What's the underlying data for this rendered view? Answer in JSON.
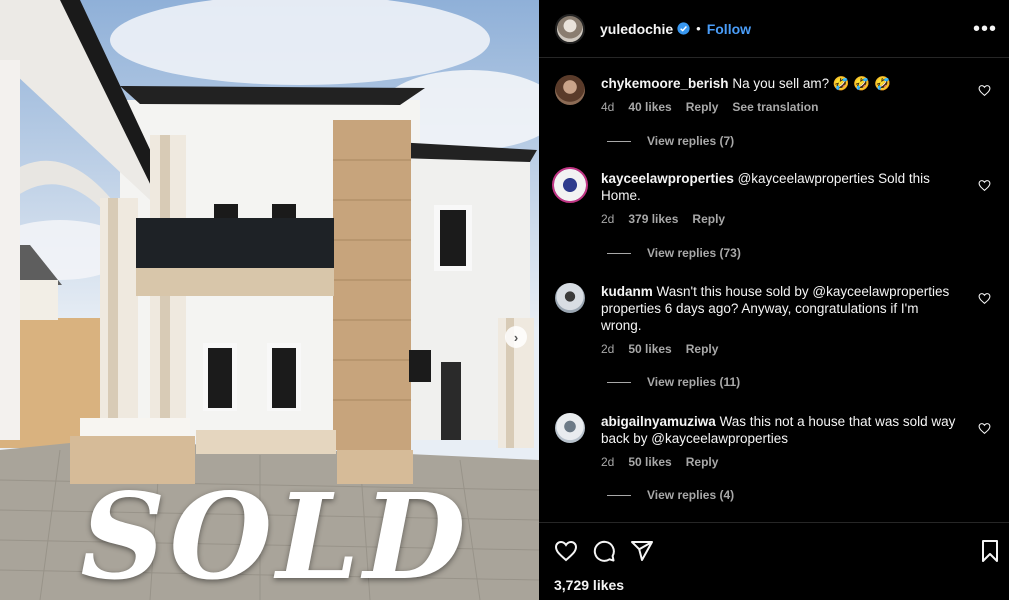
{
  "photo": {
    "overlay_text": "SOLD",
    "next_icon": "chevron-right-icon"
  },
  "header": {
    "username": "yuledochie",
    "verified_icon": "verified-badge-icon",
    "separator": "•",
    "follow_label": "Follow",
    "more_icon": "more-options-icon"
  },
  "comments": [
    {
      "user": "chykemoore_berish",
      "text": "Na you sell am? 🤣 🤣 🤣",
      "age": "4d",
      "likes": "40 likes",
      "reply_label": "Reply",
      "translate_label": "See translation",
      "view_replies": "View replies (7)"
    },
    {
      "user": "kayceelawproperties",
      "text": "@kayceelawproperties Sold this Home.",
      "age": "2d",
      "likes": "379 likes",
      "reply_label": "Reply",
      "view_replies": "View replies (73)"
    },
    {
      "user": "kudanm",
      "text": "Wasn't this house sold by @kayceelawproperties properties 6 days ago? Anyway, congratulations if I'm wrong.",
      "age": "2d",
      "likes": "50 likes",
      "reply_label": "Reply",
      "view_replies": "View replies (11)"
    },
    {
      "user": "abigailnyamuziwa",
      "text": "Was this not a house that was sold way back by @kayceelawproperties",
      "age": "2d",
      "likes": "50 likes",
      "reply_label": "Reply",
      "view_replies": "View replies (4)"
    }
  ],
  "actions": {
    "like_icon": "heart-icon",
    "comment_icon": "comment-icon",
    "share_icon": "share-icon",
    "save_icon": "bookmark-icon",
    "likes_count": "3,729 likes"
  },
  "colors": {
    "background": "#000000",
    "accent": "#4a9df8",
    "muted_text": "#a8a8a8",
    "divider": "#262626"
  }
}
